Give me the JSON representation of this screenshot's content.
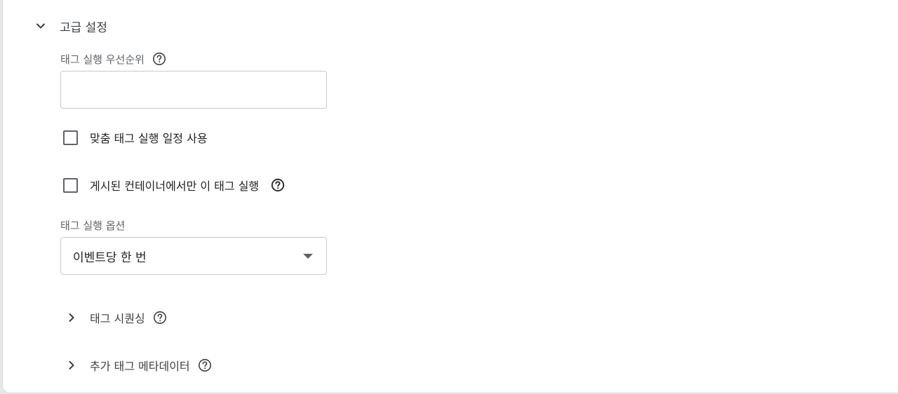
{
  "advanced_settings": {
    "title": "고급 설정",
    "expand_icon": "chevron-down-icon"
  },
  "tag_firing_priority": {
    "label": "태그 실행 우선순위",
    "value": "",
    "placeholder": "",
    "help_icon": "help-circle-icon"
  },
  "custom_schedule": {
    "label": "맞춤 태그 실행 일정 사용",
    "checked": false
  },
  "published_only": {
    "label": "게시된 컨테이너에서만 이 태그 실행",
    "checked": false,
    "help_icon": "help-circle-icon"
  },
  "tag_firing_options": {
    "label": "태그 실행 옵션",
    "selected": "이벤트당 한 번",
    "dropdown_icon": "caret-down-icon"
  },
  "tag_sequencing": {
    "label": "태그 시퀀싱",
    "expand_icon": "chevron-right-icon",
    "help_icon": "help-circle-icon"
  },
  "additional_metadata": {
    "label": "추가 태그 메타데이터",
    "expand_icon": "chevron-right-icon",
    "help_icon": "help-circle-icon"
  },
  "colors": {
    "text_primary": "#202124",
    "text_secondary": "#5f6368",
    "border": "#c9c9c9",
    "background": "#ffffff"
  }
}
